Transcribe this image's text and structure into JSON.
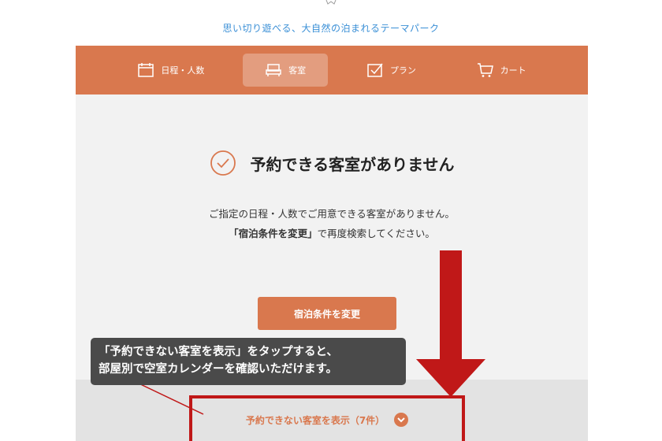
{
  "header": {
    "tagline": "思い切り遊べる、大自然の泊まれるテーマパーク"
  },
  "nav": {
    "items": [
      {
        "label": "日程・人数",
        "icon": "calendar-icon",
        "active": false
      },
      {
        "label": "客室",
        "icon": "sofa-icon",
        "active": true
      },
      {
        "label": "プラン",
        "icon": "checkbox-icon",
        "active": false
      },
      {
        "label": "カート",
        "icon": "cart-icon",
        "active": false
      }
    ]
  },
  "main": {
    "heading": "予約できる客室がありません",
    "message_line1": "ご指定の日程・人数でご用意できる客室がありません。",
    "message_line2_bold": "「宿泊条件を変更」",
    "message_line2_rest": "で再度検索してください。",
    "change_button_label": "宿泊条件を変更",
    "show_unavailable_label": "予約できない客室を表示（7件）"
  },
  "annotation": {
    "line1": "「予約できない客室を表示」をタップすると、",
    "line2": "部屋別で空室カレンダーを確認いただけます。"
  },
  "colors": {
    "accent": "#d9784e",
    "link_blue": "#3a8fd6",
    "highlight_red": "#c01818",
    "callout_bg": "#4a4a4a"
  }
}
